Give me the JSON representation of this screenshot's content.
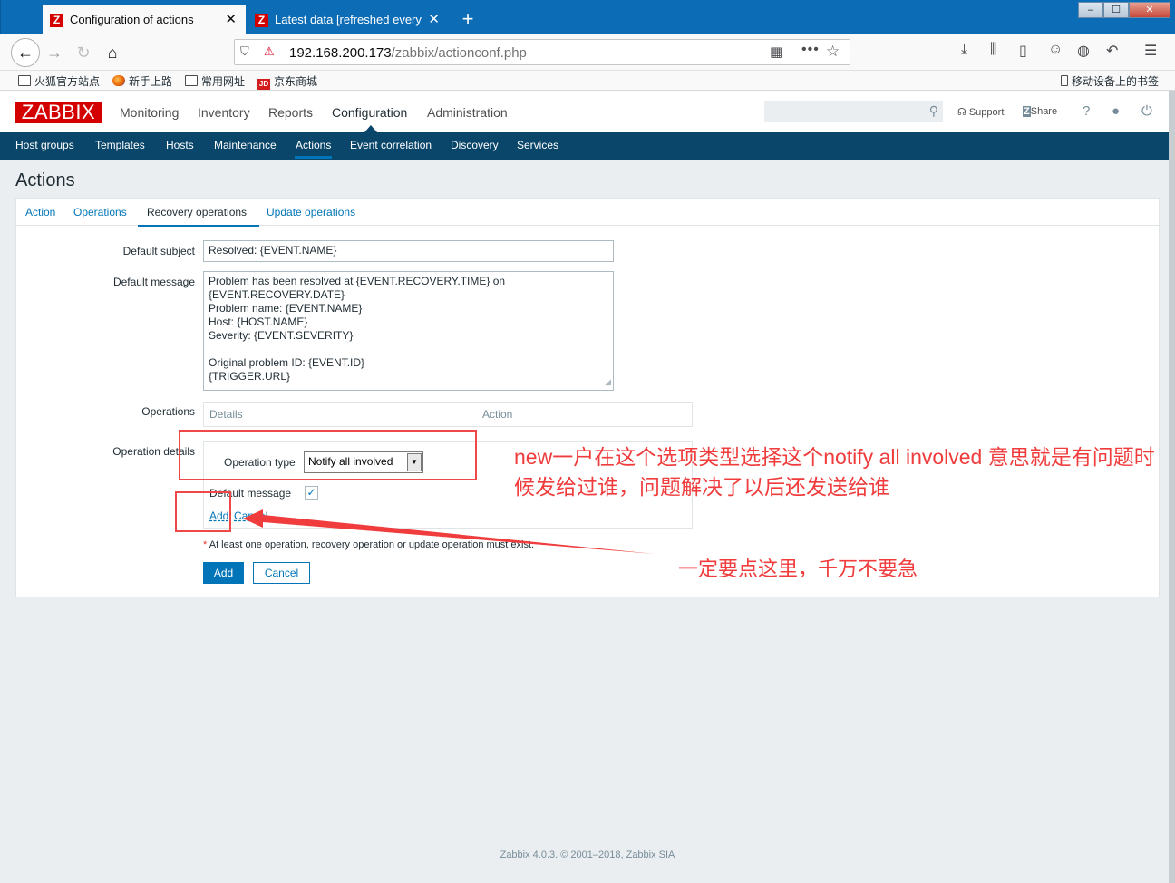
{
  "browser": {
    "tabs": [
      {
        "title": "Configuration of actions",
        "active": true
      },
      {
        "title": "Latest data [refreshed every",
        "active": false
      }
    ],
    "favicon_letter": "Z",
    "tab_close": "✕",
    "new_tab": "+",
    "url_host": "192.168.200.173",
    "url_path": "/zabbix/actionconf.php",
    "window_controls": {
      "min": "‒",
      "max": "☐",
      "close": "✕"
    },
    "bookmarks": [
      "火狐官方站点",
      "新手上路",
      "常用网址",
      "京东商城"
    ],
    "jd_icon": "JD",
    "mobile_bookmarks": "移动设备上的书签"
  },
  "zabbix": {
    "logo": "ZABBIX",
    "main_menu": [
      "Monitoring",
      "Inventory",
      "Reports",
      "Configuration",
      "Administration"
    ],
    "selected_menu": "Configuration",
    "header_links": {
      "support": "Support",
      "share": "Share",
      "help": "?"
    },
    "sub_menu": [
      "Host groups",
      "Templates",
      "Hosts",
      "Maintenance",
      "Actions",
      "Event correlation",
      "Discovery",
      "Services"
    ],
    "selected_sub": "Actions"
  },
  "page": {
    "title": "Actions",
    "tabs": [
      "Action",
      "Operations",
      "Recovery operations",
      "Update operations"
    ],
    "active_tab": "Recovery operations",
    "form": {
      "default_subject_label": "Default subject",
      "default_subject_value": "Resolved: {EVENT.NAME}",
      "default_message_label": "Default message",
      "default_message_value": "Problem has been resolved at {EVENT.RECOVERY.TIME} on\n{EVENT.RECOVERY.DATE}\nProblem name: {EVENT.NAME}\nHost: {HOST.NAME}\nSeverity: {EVENT.SEVERITY}\n\nOriginal problem ID: {EVENT.ID}\n{TRIGGER.URL}",
      "operations_label": "Operations",
      "operations_columns": [
        "Details",
        "Action"
      ],
      "operation_details_label": "Operation details",
      "operation_type_label": "Operation type",
      "operation_type_value": "Notify all involved",
      "default_message_check_label": "Default message",
      "default_message_checked": true,
      "inline_add": "Add",
      "inline_cancel": "Cancel",
      "required_note": "At least one operation, recovery operation or update operation must exist.",
      "add_button": "Add",
      "cancel_button": "Cancel"
    }
  },
  "footer": {
    "text": "Zabbix 4.0.3. © 2001–2018,",
    "link": "Zabbix SIA"
  },
  "annotations": {
    "note_operation_type": "new一户在这个选项类型选择这个notify all involved 意思就是有问题时候发给过谁，问题解决了以后还发送给谁",
    "note_click_add": "一定要点这里，千万不要急"
  },
  "colors": {
    "zabbix_red": "#d40000",
    "submenu_bg": "#0a466a",
    "link_blue": "#0275b8",
    "annotation_red": "#f03c3c"
  }
}
